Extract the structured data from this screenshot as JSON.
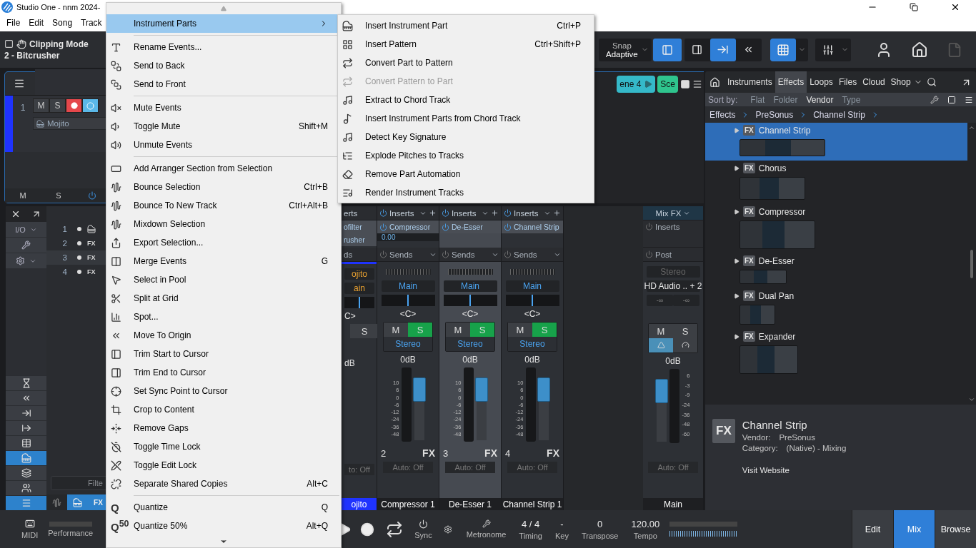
{
  "window": {
    "title": "Studio One - nnm 2024-"
  },
  "menubar": [
    "File",
    "Edit",
    "Song",
    "Track"
  ],
  "toolbar": {
    "mode": "Clipping Mode",
    "track": "2 - Bitcrusher",
    "snap_label": "Snap",
    "snap_value": "Adaptive",
    "snap_on": true,
    "grid_on": true
  },
  "inspector": {
    "number": "1",
    "mute": "M",
    "solo": "S",
    "record": true,
    "monitor": true,
    "instrument": "Mojito",
    "footer": [
      "M",
      "S"
    ]
  },
  "scenes": [
    {
      "label": "ene 4",
      "color": "#35b9c9"
    },
    {
      "label": "Sce",
      "color": "#2fc58e"
    }
  ],
  "mixer_nav": {
    "io": "I/O",
    "buttons": [
      {
        "selected": false
      },
      {
        "selected": false
      },
      {
        "selected": false
      },
      {
        "selected": false
      },
      {
        "selected": false
      },
      {
        "selected": true
      },
      {
        "selected": false
      },
      {
        "selected": false
      },
      {
        "selected": true
      }
    ]
  },
  "tracks": [
    {
      "number": "1",
      "kind": "instrument",
      "selected": false
    },
    {
      "number": "2",
      "kind": "fx",
      "tag": "FX",
      "selected": false
    },
    {
      "number": "3",
      "kind": "fx",
      "tag": "FX",
      "selected": true
    },
    {
      "number": "4",
      "kind": "fx",
      "tag": "FX",
      "selected": false
    }
  ],
  "track_filter": {
    "placeholder": "Filte"
  },
  "track_tabs": [
    {
      "kind": "wave",
      "selected": false
    },
    {
      "kind": "piano",
      "selected": true
    },
    {
      "kind": "fx",
      "label": "FX",
      "selected": true
    }
  ],
  "partial_channel": {
    "inserts": "erts",
    "slots": [
      "ofilter",
      "rusher"
    ],
    "sends": "ds",
    "input": "ojito",
    "output": "ain",
    "pan_slider": {
      "level": 0.5
    },
    "pan": "C>",
    "solo": "S",
    "volume": "dB",
    "auto": "to: Off",
    "name": "ojito"
  },
  "channels": [
    {
      "inserts": "Inserts",
      "insert": "Compressor",
      "insert_value": "0.00",
      "sends": "Sends",
      "output": "Main",
      "pan_slider": {
        "level": 0.5
      },
      "pan": "<C>",
      "mute": "M",
      "solo": "S",
      "soloed": true,
      "mode": "Stereo",
      "volume": "0dB",
      "scale": [
        "10",
        "6",
        "0",
        "-6",
        "-12",
        "-24",
        "-36",
        "-48"
      ],
      "number": "2",
      "type": "FX",
      "auto": "Auto: Off",
      "name": "Compressor 1",
      "selected": false
    },
    {
      "inserts": "Inserts",
      "insert": "De-Esser",
      "sends": "Sends",
      "output": "Main",
      "pan_slider": {
        "level": 0.5
      },
      "pan": "<C>",
      "mute": "M",
      "solo": "S",
      "soloed": true,
      "mode": "Stereo",
      "volume": "0dB",
      "scale": [
        "10",
        "6",
        "0",
        "-6",
        "-12",
        "-24",
        "-36",
        "-48"
      ],
      "number": "3",
      "type": "FX",
      "auto": "Auto: Off",
      "name": "De-Esser 1",
      "selected": true
    },
    {
      "inserts": "Inserts",
      "insert": "Channel Strip",
      "sends": "Sends",
      "output": "Main",
      "pan_slider": {
        "level": 0.5
      },
      "pan": "<C>",
      "mute": "M",
      "solo": "S",
      "soloed": true,
      "mode": "Stereo",
      "volume": "0dB",
      "scale": [
        "10",
        "6",
        "0",
        "-6",
        "-12",
        "-24",
        "-36",
        "-48"
      ],
      "number": "4",
      "type": "FX",
      "auto": "Auto: Off",
      "name": "Channel Strip 1",
      "selected": false
    }
  ],
  "main_channel": {
    "mix_fx": "Mix FX",
    "inserts": "Inserts",
    "post": "Post",
    "input": "Stereo",
    "output": "HD Audio .. + 2",
    "peaks": [
      "-∞",
      "-∞"
    ],
    "mute": "M",
    "solo": "S",
    "volume": "0dB",
    "scale": [
      "6",
      "-3",
      "-9",
      "-24",
      "-36",
      "-48",
      "-60"
    ],
    "auto": "Auto: Off",
    "name": "Main"
  },
  "browser": {
    "tabs": [
      {
        "label": "Instruments",
        "selected": false
      },
      {
        "label": "Effects",
        "selected": true
      },
      {
        "label": "Loops",
        "selected": false
      },
      {
        "label": "Files",
        "selected": false
      },
      {
        "label": "Cloud",
        "selected": false
      },
      {
        "label": "Shop",
        "selected": false
      }
    ],
    "sort_label": "Sort by:",
    "sort_options": [
      {
        "label": "Flat",
        "selected": false
      },
      {
        "label": "Folder",
        "selected": false
      },
      {
        "label": "Vendor",
        "selected": true
      },
      {
        "label": "Type",
        "selected": false
      }
    ],
    "breadcrumb": [
      "Effects",
      "PreSonus",
      "Channel Strip"
    ],
    "items": [
      {
        "name": "Channel Strip",
        "badge": "FX",
        "selected": true
      },
      {
        "name": "Chorus",
        "badge": "FX",
        "selected": false
      },
      {
        "name": "Compressor",
        "badge": "FX",
        "selected": false
      },
      {
        "name": "De-Esser",
        "badge": "FX",
        "selected": false
      },
      {
        "name": "Dual Pan",
        "badge": "FX",
        "selected": false
      },
      {
        "name": "Expander",
        "badge": "FX",
        "selected": false
      }
    ],
    "info": {
      "badge": "FX",
      "name": "Channel Strip",
      "vendor_label": "Vendor:",
      "vendor": "PreSonus",
      "category_label": "Category:",
      "category": "(Native) - Mixing",
      "link": "Visit Website"
    }
  },
  "transport": {
    "midi": "MIDI",
    "performance": "Performance",
    "sync": "Sync",
    "metronome": "Metronome",
    "fields": [
      {
        "value": "4 / 4",
        "label": "Timing"
      },
      {
        "value": "-",
        "label": "Key"
      },
      {
        "value": "0",
        "label": "Transpose"
      },
      {
        "value": "120.00",
        "label": "Tempo"
      }
    ],
    "views": [
      {
        "label": "Edit",
        "selected": false
      },
      {
        "label": "Mix",
        "selected": true
      },
      {
        "label": "Browse",
        "selected": false
      }
    ]
  },
  "context_menu": {
    "sections": [
      [
        {
          "label": "Instrument Parts",
          "submenu": true,
          "selected": true
        }
      ],
      [
        {
          "label": "Rename Events...",
          "selected": false
        },
        {
          "label": "Send to Back",
          "selected": false
        },
        {
          "label": "Send to Front",
          "selected": false
        }
      ],
      [
        {
          "label": "Mute Events",
          "selected": false
        },
        {
          "label": "Toggle Mute",
          "shortcut": "Shift+M",
          "selected": false
        },
        {
          "label": "Unmute Events",
          "selected": false
        }
      ],
      [
        {
          "label": "Add Arranger Section from Selection",
          "selected": false
        },
        {
          "label": "Bounce Selection",
          "shortcut": "Ctrl+B",
          "selected": false
        },
        {
          "label": "Bounce To New Track",
          "shortcut": "Ctrl+Alt+B",
          "selected": false
        },
        {
          "label": "Mixdown Selection",
          "selected": false
        },
        {
          "label": "Export Selection...",
          "selected": false
        },
        {
          "label": "Merge Events",
          "shortcut": "G",
          "selected": false
        },
        {
          "label": "Select in Pool",
          "selected": false
        },
        {
          "label": "Split at Grid",
          "selected": false
        },
        {
          "label": "Spot...",
          "selected": false
        },
        {
          "label": "Move To Origin",
          "selected": false
        },
        {
          "label": "Trim Start to Cursor",
          "selected": false
        },
        {
          "label": "Trim End to Cursor",
          "selected": false
        },
        {
          "label": "Set Sync Point to Cursor",
          "selected": false
        },
        {
          "label": "Crop to Content",
          "selected": false
        },
        {
          "label": "Remove Gaps",
          "selected": false
        },
        {
          "label": "Toggle Time Lock",
          "selected": false
        },
        {
          "label": "Toggle Edit Lock",
          "selected": false
        },
        {
          "label": "Separate Shared Copies",
          "shortcut": "Alt+C",
          "selected": false
        }
      ],
      [
        {
          "label": "Quantize",
          "icon_text": "Q",
          "shortcut": "Q",
          "selected": false
        },
        {
          "label": "Quantize 50%",
          "icon_text": "Q$^{50}$",
          "shortcut": "Alt+Q",
          "selected": false
        }
      ]
    ]
  },
  "submenu": {
    "items": [
      {
        "label": "Insert Instrument Part",
        "shortcut": "Ctrl+P",
        "disabled": false
      },
      {
        "label": "Insert Pattern",
        "shortcut": "Ctrl+Shift+P",
        "disabled": false
      },
      {
        "label": "Convert Part to Pattern",
        "disabled": false
      },
      {
        "label": "Convert Pattern to Part",
        "disabled": true
      },
      {
        "label": "Extract to Chord Track",
        "disabled": false
      },
      {
        "label": "Insert Instrument Parts from Chord Track",
        "disabled": false
      },
      {
        "label": "Detect Key Signature",
        "disabled": false
      },
      {
        "label": "Explode Pitches to Tracks",
        "disabled": false
      },
      {
        "label": "Remove Part Automation",
        "disabled": false
      },
      {
        "label": "Render Instrument Tracks",
        "disabled": false
      }
    ]
  }
}
